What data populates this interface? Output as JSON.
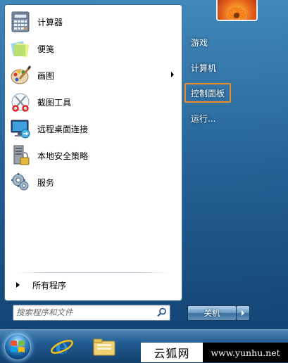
{
  "start_menu": {
    "programs": [
      {
        "label": "计算器",
        "icon": "calculator-icon",
        "has_submenu": false
      },
      {
        "label": "便笺",
        "icon": "sticky-notes-icon",
        "has_submenu": false
      },
      {
        "label": "画图",
        "icon": "paint-icon",
        "has_submenu": true
      },
      {
        "label": "截图工具",
        "icon": "snipping-tool-icon",
        "has_submenu": false
      },
      {
        "label": "远程桌面连接",
        "icon": "remote-desktop-icon",
        "has_submenu": false
      },
      {
        "label": "本地安全策略",
        "icon": "local-security-policy-icon",
        "has_submenu": false
      },
      {
        "label": "服务",
        "icon": "services-gear-icon",
        "has_submenu": false
      }
    ],
    "all_programs_label": "所有程序",
    "search": {
      "placeholder": "搜索程序和文件",
      "icon": "search-icon"
    },
    "right_items": [
      {
        "label": "游戏",
        "selected": false
      },
      {
        "label": "计算机",
        "selected": false
      },
      {
        "label": "控制面板",
        "selected": true
      },
      {
        "label": "运行...",
        "selected": false
      }
    ],
    "shutdown_label": "关机",
    "highlight_color": "#f08a2a"
  },
  "taskbar": {
    "items": [
      {
        "name": "start-orb",
        "icon": "windows-logo-icon"
      },
      {
        "name": "internet-explorer",
        "icon": "ie-icon"
      },
      {
        "name": "windows-explorer",
        "icon": "folder-icon"
      }
    ]
  },
  "watermark": {
    "left_text": "云狐网",
    "right_text": "www.yunhu.net"
  }
}
